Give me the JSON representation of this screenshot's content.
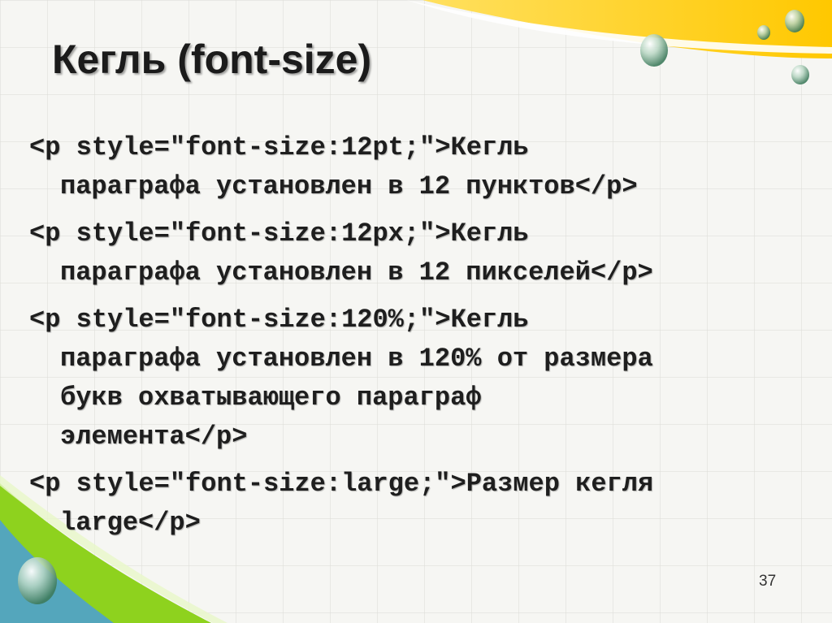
{
  "slide": {
    "title": "Кегль (font-size)",
    "number": "37",
    "paragraphs": [
      {
        "lines": [
          "<p style=\"font-size:12pt;\">Кегль",
          "параграфа установлен в 12 пунктов</p>"
        ]
      },
      {
        "lines": [
          "<p style=\"font-size:12px;\">Кегль",
          "параграфа установлен в 12 пикселей</p>"
        ]
      },
      {
        "lines": [
          "<p style=\"font-size:120%;\">Кегль",
          "параграфа установлен в 120% от размера",
          "букв охватывающего параграф",
          "элемента</p>"
        ]
      },
      {
        "lines": [
          "<p style=\"font-size:large;\">Размер кегля",
          "large</p>"
        ]
      }
    ]
  },
  "colors": {
    "background": "#f6f6f3",
    "accent_yellow": "#ffd21a",
    "accent_green": "#8ed21e",
    "accent_blue": "#4a9fd8",
    "text": "#1e1e1e"
  },
  "decorations": [
    "water-drop-icon",
    "water-drop-icon",
    "water-drop-icon",
    "water-drop-icon",
    "water-drop-icon"
  ]
}
